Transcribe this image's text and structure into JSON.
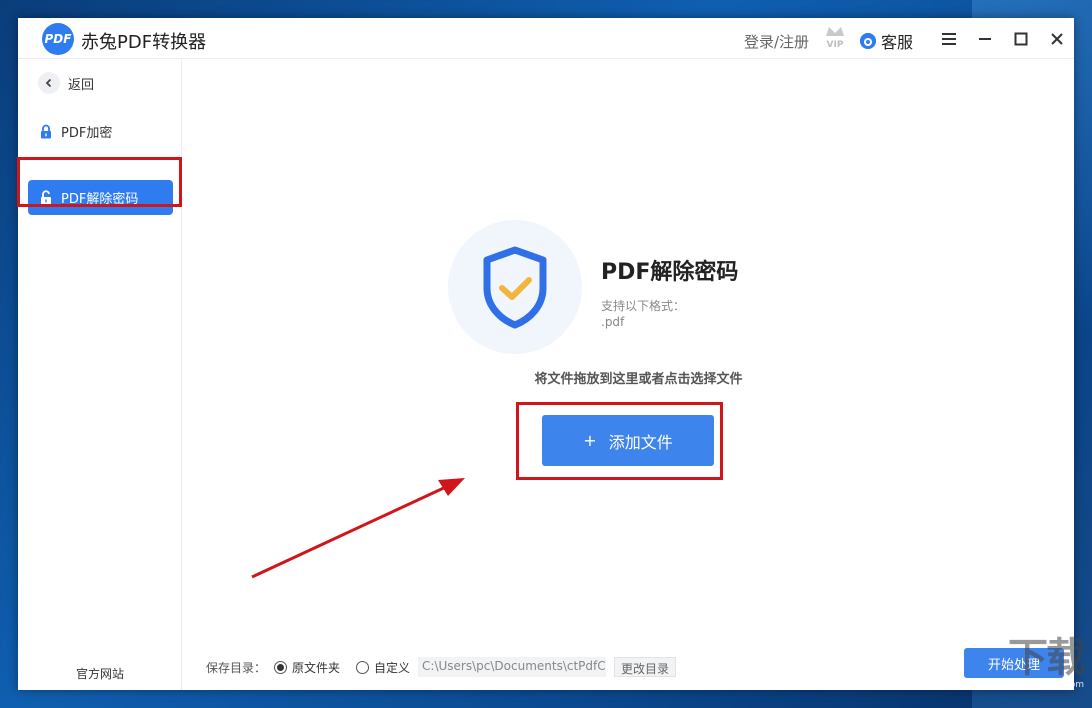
{
  "app": {
    "logo_text": "PDF",
    "title": "赤兔PDF转换器",
    "login_label": "登录/注册",
    "vip_label": "VIP",
    "service_label": "客服"
  },
  "window_controls": {
    "menu_icon": "hamburger-icon",
    "minimize_icon": "minimize-icon",
    "maximize_icon": "maximize-icon",
    "close_icon": "close-icon"
  },
  "sidebar": {
    "back_label": "返回",
    "items": [
      {
        "label": "PDF加密",
        "icon": "lock-icon",
        "active": false
      },
      {
        "label": "PDF解除密码",
        "icon": "unlock-icon",
        "active": true
      }
    ],
    "footer_link": "官方网站"
  },
  "main": {
    "feature_title": "PDF解除密码",
    "formats_label": "支持以下格式：",
    "formats_value": ".pdf",
    "drop_hint": "将文件拖放到这里或者点击选择文件",
    "add_button_icon": "+",
    "add_button_label": "添加文件"
  },
  "footer": {
    "save_dir_label": "保存目录：",
    "option_original": "原文件夹",
    "option_custom": "自定义",
    "selected_option": "原文件夹",
    "path_value": "C:\\Users\\pc\\Documents\\ctPdfConverter",
    "change_dir_label": "更改目录",
    "start_label": "开始处理"
  },
  "watermark": {
    "text": "www.xiazaiba.com"
  },
  "colors": {
    "accent": "#3e84ed",
    "highlight": "#d0161b",
    "shield_blue": "#2f6fe8",
    "check_yellow": "#f2b63c"
  }
}
